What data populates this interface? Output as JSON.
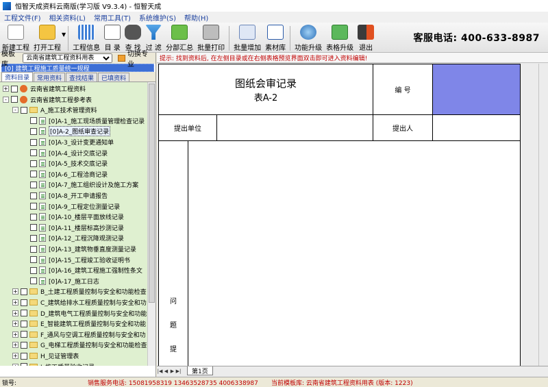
{
  "window": {
    "title": "恒智天成资料云南版(学习版 V9.3.4) - 恒智天成"
  },
  "menu": [
    "工程文件(F)",
    "相关资料(L)",
    "常用工具(T)",
    "系统维护(S)",
    "帮助(H)"
  ],
  "toolbar": {
    "new_project": "新建工程",
    "open_project": "打开工程",
    "project_info": "工程信息",
    "catalog": "目 录",
    "find": "查 找",
    "filter": "过 滤",
    "subtotal": "分部汇总",
    "batch_print": "批量打印",
    "batch_add": "批量增加",
    "materials": "素材库",
    "feature_upgrade": "功能升级",
    "sheet_upgrade": "表格升级",
    "exit": "退出",
    "hotline": "客服电话: 400-633-8987"
  },
  "left": {
    "template_label": "模板库",
    "template_value": "云南省建筑工程资料用表",
    "switch_label": "切换专业",
    "selected_item": "[0] 建筑工程施工质量统一规程",
    "tabs": [
      "资料目录",
      "常用资料",
      "查找结果",
      "已填资料"
    ],
    "tree": [
      {
        "level": 0,
        "exp": "+",
        "label": "云南省建筑工程资料",
        "icon": "root"
      },
      {
        "level": 0,
        "exp": "-",
        "label": "云南省建筑工程参考表",
        "icon": "root"
      },
      {
        "level": 1,
        "exp": "-",
        "label": "A_施工技术管理资料",
        "icon": "folder"
      },
      {
        "level": 2,
        "label": "[0]A-1_施工现场质量管理检查记录",
        "icon": "doc"
      },
      {
        "level": 2,
        "label": "[0]A-2_图纸审查记录",
        "icon": "doc",
        "selected": true
      },
      {
        "level": 2,
        "label": "[0]A-3_设计变更通知单",
        "icon": "doc"
      },
      {
        "level": 2,
        "label": "[0]A-4_设计交底记录",
        "icon": "doc"
      },
      {
        "level": 2,
        "label": "[0]A-5_技术交底记录",
        "icon": "doc"
      },
      {
        "level": 2,
        "label": "[0]A-6_工程洽商记录",
        "icon": "doc"
      },
      {
        "level": 2,
        "label": "[0]A-7_施工组织设计及施工方案",
        "icon": "doc"
      },
      {
        "level": 2,
        "label": "[0]A-8_开工申请报告",
        "icon": "doc"
      },
      {
        "level": 2,
        "label": "[0]A-9_工程定位测量记录",
        "icon": "doc"
      },
      {
        "level": 2,
        "label": "[0]A-10_楼层平面放线记录",
        "icon": "doc"
      },
      {
        "level": 2,
        "label": "[0]A-11_楼层标高抄测记录",
        "icon": "doc"
      },
      {
        "level": 2,
        "label": "[0]A-12_工程沉降观测记录",
        "icon": "doc"
      },
      {
        "level": 2,
        "label": "[0]A-13_建筑物垂直度测量记录",
        "icon": "doc"
      },
      {
        "level": 2,
        "label": "[0]A-15_工程竣工验收证明书",
        "icon": "doc"
      },
      {
        "level": 2,
        "label": "[0]A-16_建筑工程施工强制性条文",
        "icon": "doc"
      },
      {
        "level": 2,
        "label": "[0]A-17_施工日志",
        "icon": "doc"
      },
      {
        "level": 1,
        "exp": "+",
        "label": "B_土建工程质量控制与安全和功能检查",
        "icon": "folder"
      },
      {
        "level": 1,
        "exp": "+",
        "label": "C_建筑给排水工程质量控制与安全和功",
        "icon": "folder"
      },
      {
        "level": 1,
        "exp": "+",
        "label": "D_建筑电气工程质量控制与安全和功能",
        "icon": "folder"
      },
      {
        "level": 1,
        "exp": "+",
        "label": "E_智能建筑工程质量控制与安全和功能",
        "icon": "folder"
      },
      {
        "level": 1,
        "exp": "+",
        "label": "F_通风与空调工程质量控制与安全和功",
        "icon": "folder"
      },
      {
        "level": 1,
        "exp": "+",
        "label": "G_电梯工程质量控制与安全和功能检查",
        "icon": "folder"
      },
      {
        "level": 1,
        "exp": "+",
        "label": "H_见证管理表",
        "icon": "folder"
      },
      {
        "level": 1,
        "exp": "+",
        "label": "I_施工质量验收记录",
        "icon": "folder"
      }
    ]
  },
  "right": {
    "hint": "提示: 找到资料后, 在左侧目录或在右侧表格预览界面双击即可进入资料编辑!",
    "form": {
      "title": "图纸会审记录",
      "subtitle": "表A-2",
      "number_label": "编 号",
      "submit_unit_label": "提出单位",
      "submitter_label": "提出人",
      "issue_chars": [
        "问",
        "题",
        "提"
      ]
    },
    "sheet_tab": "第1页"
  },
  "status": {
    "left": "锁号:",
    "sales": "销售服务电话: 15081958319 13463528735 4006338987",
    "template": "当前模板库: 云南省建筑工程资料用表 (版本: 1223)"
  },
  "colors": {
    "highlight_cell": "#7f86e8",
    "tree_bg": "#dff0d0",
    "hint_text": "#c00000",
    "selection": "#3d6fd6"
  }
}
